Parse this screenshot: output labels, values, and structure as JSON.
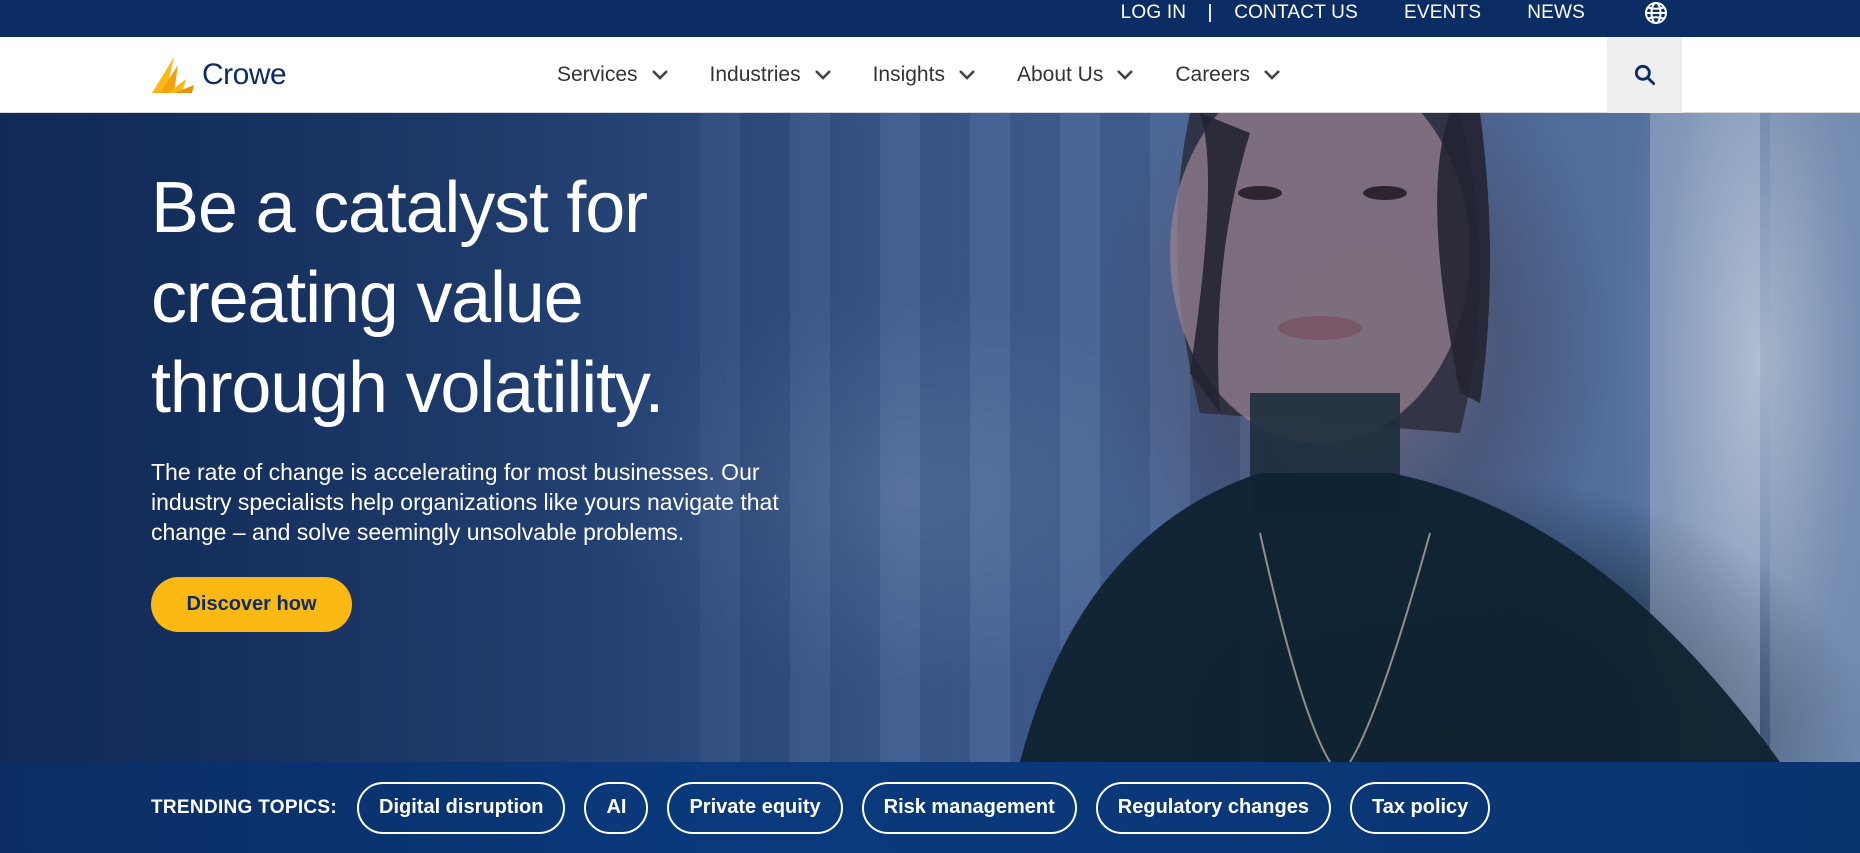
{
  "utility_bar": {
    "links": [
      "LOG IN",
      "CONTACT US",
      "EVENTS",
      "NEWS"
    ],
    "globe_icon": "globe-icon"
  },
  "nav": {
    "logo_text": "Crowe",
    "items": [
      {
        "label": "Services"
      },
      {
        "label": "Industries"
      },
      {
        "label": "Insights"
      },
      {
        "label": "About Us"
      },
      {
        "label": "Careers"
      }
    ],
    "search_icon": "search-icon"
  },
  "hero": {
    "title_lines": [
      "Be a catalyst for",
      "creating value",
      "through volatility."
    ],
    "body": "The rate of change is accelerating for most businesses. Our industry specialists help organizations like yours navigate that change – and solve seemingly unsolvable problems.",
    "cta_label": "Discover how"
  },
  "trending": {
    "label": "TRENDING TOPICS:",
    "topics": [
      "Digital disruption",
      "AI",
      "Private equity",
      "Risk management",
      "Regulatory changes",
      "Tax policy"
    ]
  },
  "colors": {
    "brand_navy": "#0b2d63",
    "brand_gold": "#fdb913",
    "search_bg": "#eeeeee"
  }
}
